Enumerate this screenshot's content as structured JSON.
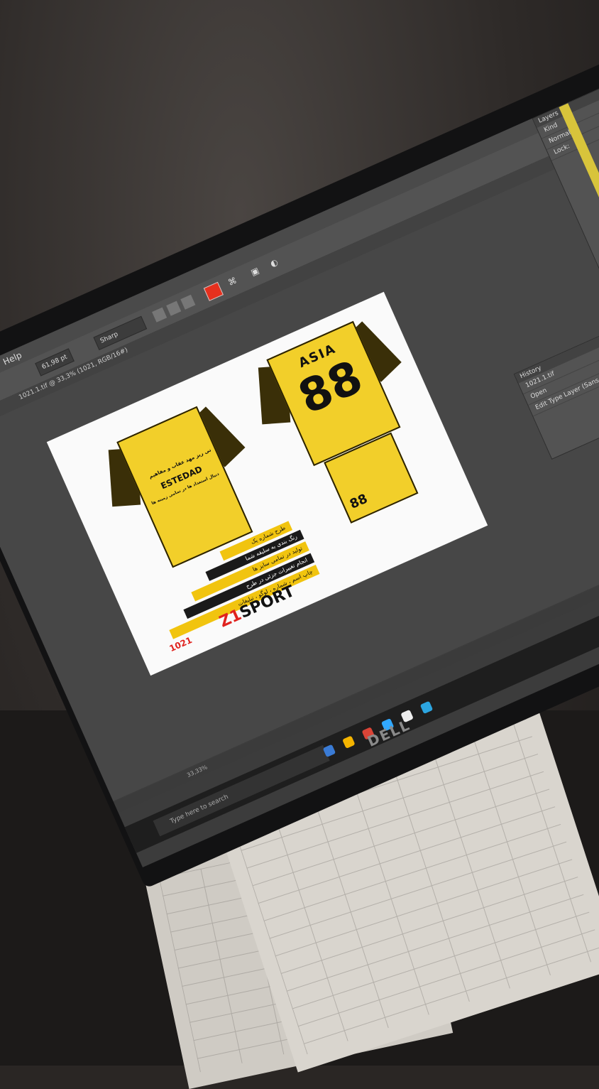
{
  "menu": {
    "help": "Help"
  },
  "options": {
    "font_size": "61,98 pt",
    "antialias": "Sharp"
  },
  "document": {
    "tab_title": "1021.1.tif @ 33,3% (1021, RGB/16#)"
  },
  "artwork": {
    "back_name": "ASIA",
    "back_number": "88",
    "shorts_number": "88",
    "chest_word": "ESTEDAD",
    "chest_line1": "نی ریز مهد عقاب و مفاهیم",
    "chest_line2": "دنبال استعداد ها در تمامی زمینه ها",
    "features": [
      "طرح شماره یک",
      "رنگ بندی به سلیقه شما",
      "تولید در تمامی سایز ها",
      "انجام تغییرات جزئی در طرح",
      "چاپ اسم ، شماره ، لوگو ، تبلیغات"
    ],
    "brand_accent": "Z1",
    "brand_rest": "SPORT",
    "code": "1021"
  },
  "panels": {
    "history_title": "History",
    "history_rows": [
      "1021.1.tif",
      "Open",
      "Edit Type Layer (Sans-Ar)"
    ],
    "layers_title": "Layers",
    "layers_kind": "Kind",
    "layers_mode": "Normal",
    "layers_lock": "Lock:"
  },
  "taskbar": {
    "search_placeholder": "Type here to search"
  },
  "statusbar": {
    "zoom": "33,33%"
  },
  "monitor": {
    "brand": "DELL"
  },
  "colors": {
    "jersey_yellow": "#f2cf2a",
    "brand_red": "#e0231f",
    "photoshop_dark": "#3c3c3c"
  }
}
